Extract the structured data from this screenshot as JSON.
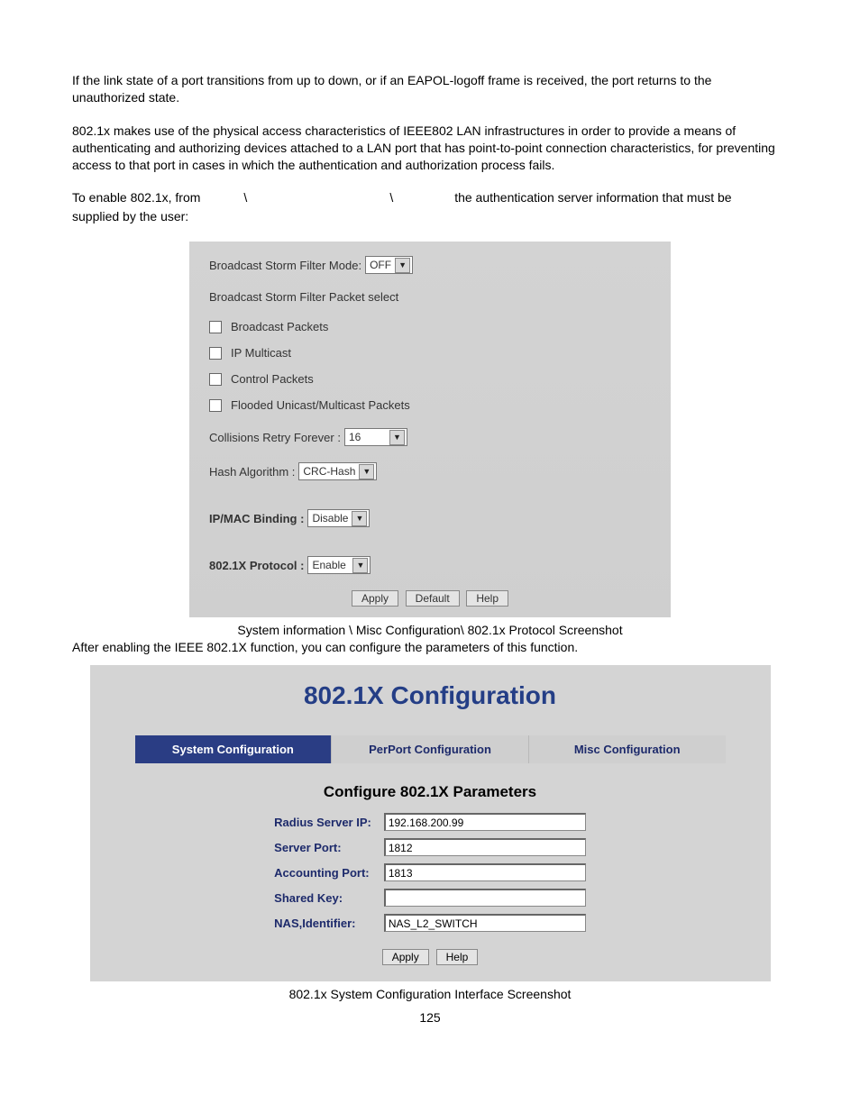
{
  "paragraphs": {
    "p1": "If the link state of a port transitions from up to down, or if an EAPOL-logoff frame is received, the port returns to the unauthorized state.",
    "p2": "802.1x makes use of the physical access characteristics of IEEE802 LAN infrastructures in order to provide a means of authenticating and authorizing devices attached to a LAN port that has point-to-point connection characteristics, for preventing access to that port in cases in which the authentication and authorization process fails.",
    "p3a": "To enable 802.1x, from",
    "p3b": "\\",
    "p3c": "\\",
    "p3d": "the authentication server information that must be",
    "p3e": "supplied by the user:"
  },
  "panel1": {
    "filter_mode_label": "Broadcast Storm Filter Mode:",
    "filter_mode_value": "OFF",
    "packet_select_label": "Broadcast Storm Filter Packet select",
    "cb1": "Broadcast Packets",
    "cb2": "IP Multicast",
    "cb3": "Control Packets",
    "cb4": "Flooded Unicast/Multicast Packets",
    "collisions_label": "Collisions Retry Forever :",
    "collisions_value": "16",
    "hash_label": "Hash Algorithm :",
    "hash_value": "CRC-Hash",
    "ipmac_label": "IP/MAC Binding :",
    "ipmac_value": "Disable",
    "proto_label": "802.1X Protocol :",
    "proto_value": "Enable",
    "btn_apply": "Apply",
    "btn_default": "Default",
    "btn_help": "Help"
  },
  "caption1": "System information \\ Misc Configuration\\ 802.1x Protocol Screenshot",
  "after1": "After enabling the IEEE 802.1X function, you can configure the parameters of this function.",
  "panel2": {
    "title": "802.1X Configuration",
    "tab1": "System Configuration",
    "tab2": "PerPort Configuration",
    "tab3": "Misc Configuration",
    "subhead": "Configure 802.1X Parameters",
    "rows": {
      "radius_label": "Radius Server IP:",
      "radius_value": "192.168.200.99",
      "server_port_label": "Server Port:",
      "server_port_value": "1812",
      "acct_port_label": "Accounting Port:",
      "acct_port_value": "1813",
      "shared_key_label": "Shared Key:",
      "shared_key_value": "",
      "nas_label": "NAS,Identifier:",
      "nas_value": "NAS_L2_SWITCH"
    },
    "btn_apply": "Apply",
    "btn_help": "Help"
  },
  "caption2": "802.1x System Configuration Interface Screenshot",
  "pagenum": "125"
}
